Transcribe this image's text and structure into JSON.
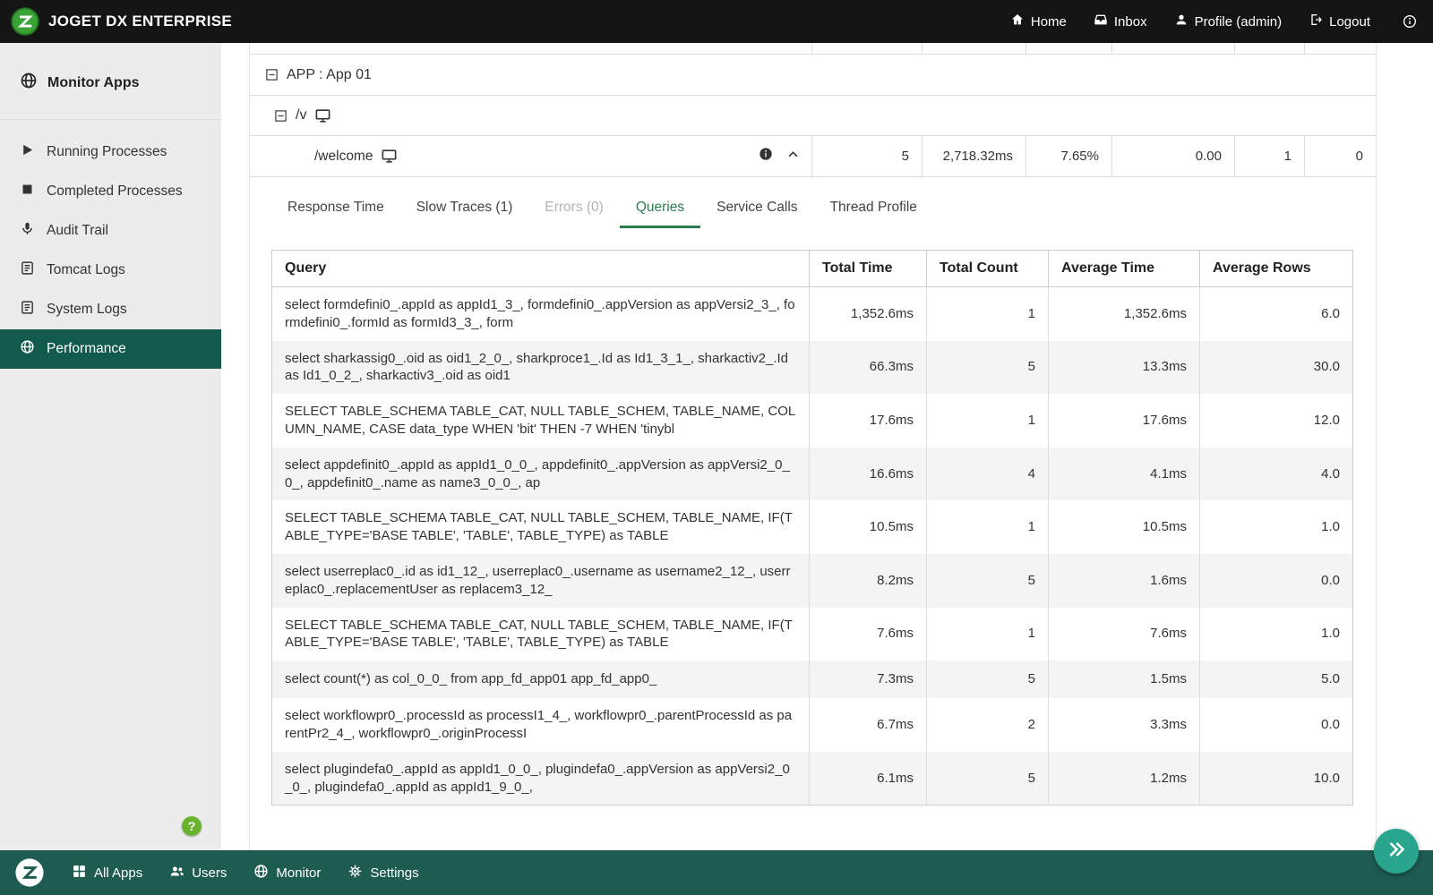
{
  "topbar": {
    "brand": "JOGET DX ENTERPRISE",
    "nav": [
      {
        "label": "Home"
      },
      {
        "label": "Inbox"
      },
      {
        "label": "Profile (admin)"
      },
      {
        "label": "Logout"
      }
    ]
  },
  "sidebar": {
    "header": "Monitor Apps",
    "items": [
      {
        "label": "Running Processes"
      },
      {
        "label": "Completed Processes"
      },
      {
        "label": "Audit Trail"
      },
      {
        "label": "Tomcat Logs"
      },
      {
        "label": "System Logs"
      },
      {
        "label": "Performance"
      }
    ]
  },
  "monitor": {
    "app_group": "APP : App 01",
    "path_group": "/v",
    "endpoint": {
      "path": "/welcome",
      "values": [
        "5",
        "2,718.32ms",
        "7.65%",
        "0.00",
        "1",
        "0"
      ]
    },
    "tabs": [
      {
        "label": "Response Time"
      },
      {
        "label": "Slow Traces (1)"
      },
      {
        "label": "Errors (0)"
      },
      {
        "label": "Queries"
      },
      {
        "label": "Service Calls"
      },
      {
        "label": "Thread Profile"
      }
    ],
    "query_table": {
      "headers": [
        "Query",
        "Total Time",
        "Total Count",
        "Average Time",
        "Average Rows"
      ],
      "rows": [
        {
          "query": "select formdefini0_.appId as appId1_3_, formdefini0_.appVersion as appVersi2_3_, formdefini0_.formId as formId3_3_, form",
          "total_time": "1,352.6ms",
          "total_count": "1",
          "avg_time": "1,352.6ms",
          "avg_rows": "6.0"
        },
        {
          "query": "select sharkassig0_.oid as oid1_2_0_, sharkproce1_.Id as Id1_3_1_, sharkactiv2_.Id as Id1_0_2_, sharkactiv3_.oid as oid1",
          "total_time": "66.3ms",
          "total_count": "5",
          "avg_time": "13.3ms",
          "avg_rows": "30.0"
        },
        {
          "query": "SELECT TABLE_SCHEMA TABLE_CAT, NULL TABLE_SCHEM, TABLE_NAME, COLUMN_NAME, CASE data_type WHEN 'bit' THEN -7 WHEN 'tinybl",
          "total_time": "17.6ms",
          "total_count": "1",
          "avg_time": "17.6ms",
          "avg_rows": "12.0"
        },
        {
          "query": "select appdefinit0_.appId as appId1_0_0_, appdefinit0_.appVersion as appVersi2_0_0_, appdefinit0_.name as name3_0_0_, ap",
          "total_time": "16.6ms",
          "total_count": "4",
          "avg_time": "4.1ms",
          "avg_rows": "4.0"
        },
        {
          "query": "SELECT TABLE_SCHEMA TABLE_CAT, NULL TABLE_SCHEM, TABLE_NAME, IF(TABLE_TYPE='BASE TABLE', 'TABLE', TABLE_TYPE) as TABLE",
          "total_time": "10.5ms",
          "total_count": "1",
          "avg_time": "10.5ms",
          "avg_rows": "1.0"
        },
        {
          "query": "select userreplac0_.id as id1_12_, userreplac0_.username as username2_12_, userreplac0_.replacementUser as replacem3_12_",
          "total_time": "8.2ms",
          "total_count": "5",
          "avg_time": "1.6ms",
          "avg_rows": "0.0"
        },
        {
          "query": "SELECT TABLE_SCHEMA TABLE_CAT, NULL TABLE_SCHEM, TABLE_NAME, IF(TABLE_TYPE='BASE TABLE', 'TABLE', TABLE_TYPE) as TABLE",
          "total_time": "7.6ms",
          "total_count": "1",
          "avg_time": "7.6ms",
          "avg_rows": "1.0"
        },
        {
          "query": "select count(*) as col_0_0_ from app_fd_app01 app_fd_app0_",
          "total_time": "7.3ms",
          "total_count": "5",
          "avg_time": "1.5ms",
          "avg_rows": "5.0"
        },
        {
          "query": "select workflowpr0_.processId as processI1_4_, workflowpr0_.parentProcessId as parentPr2_4_, workflowpr0_.originProcessI",
          "total_time": "6.7ms",
          "total_count": "2",
          "avg_time": "3.3ms",
          "avg_rows": "0.0"
        },
        {
          "query": "select plugindefa0_.appId as appId1_0_0_, plugindefa0_.appVersion as appVersi2_0_0_, plugindefa0_.appId as appId1_9_0_,",
          "total_time": "6.1ms",
          "total_count": "5",
          "avg_time": "1.2ms",
          "avg_rows": "10.0"
        }
      ]
    }
  },
  "bottombar": {
    "items": [
      {
        "label": "All Apps"
      },
      {
        "label": "Users"
      },
      {
        "label": "Monitor"
      },
      {
        "label": "Settings"
      }
    ]
  },
  "colors": {
    "brand_green": "#3aa335",
    "accent_green": "#2b7d4f",
    "sidebar_active_teal": "#135a4e",
    "footer_teal": "#1e5b51",
    "fab_teal": "#29a58e",
    "help_green": "#6ab32e"
  }
}
